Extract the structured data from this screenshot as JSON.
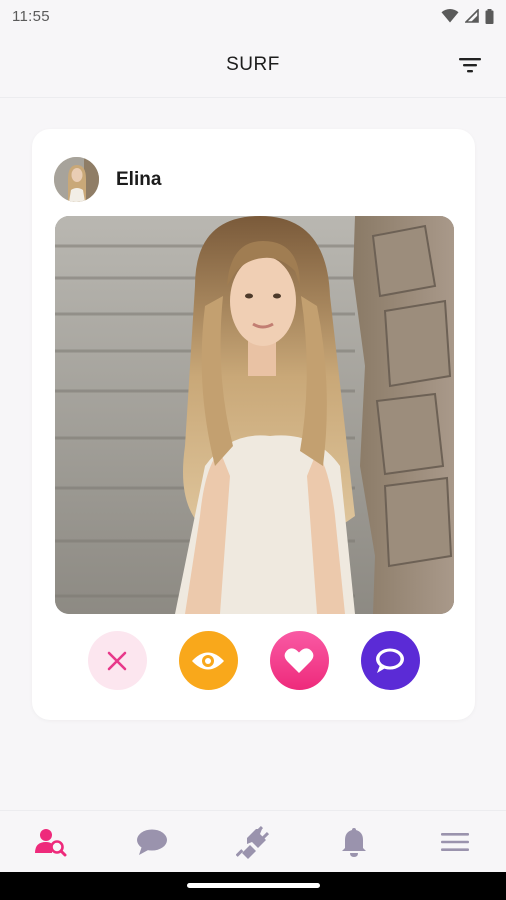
{
  "status_bar": {
    "time": "11:55"
  },
  "app_bar": {
    "title": "SURF"
  },
  "profile": {
    "name": "Elina"
  },
  "actions": [
    "dislike",
    "view-profile",
    "like",
    "message"
  ],
  "bottom_nav": {
    "active": "discover",
    "items": [
      "discover",
      "chats",
      "matches",
      "notifications",
      "menu"
    ]
  },
  "colors": {
    "accent": "#ee2a7b",
    "view": "#f9a81b",
    "chat": "#5b2bd6",
    "nav_inactive": "#9a93ad"
  }
}
